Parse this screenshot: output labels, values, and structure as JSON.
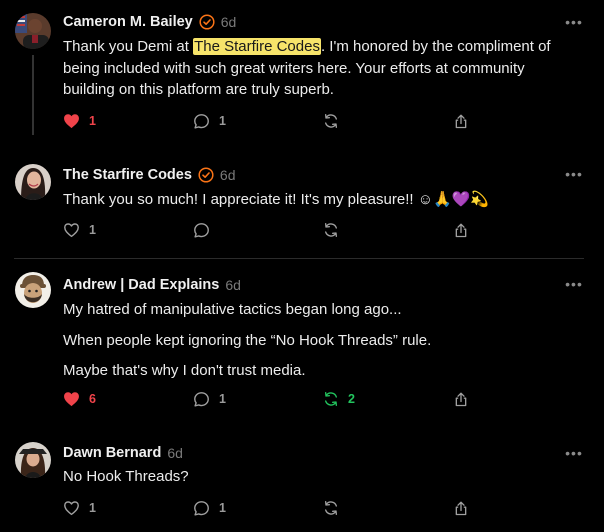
{
  "accent_color": "#f97316",
  "highlight_color": "#f7e46a",
  "like_active_color": "#f0434a",
  "repost_active_color": "#22c55e",
  "comments": [
    {
      "name": "Cameron M. Bailey",
      "verified": true,
      "time": "6d",
      "text_before": "Thank you Demi at ",
      "highlight": "The Starfire Codes",
      "text_after": ". I'm honored by the compliment of being included with such great writers here. Your efforts at community building on this platform are truly superb.",
      "likes": "1",
      "liked": true,
      "replies": "1",
      "reposts": "",
      "more_icon": "ellipsis-icon"
    },
    {
      "name": "The Starfire Codes",
      "verified": true,
      "time": "6d",
      "text": "Thank you so much! I appreciate it! It's my pleasure!! ☺🙏💜💫",
      "likes": "1",
      "liked": false,
      "replies": "",
      "reposts": ""
    },
    {
      "name": "Andrew | Dad Explains",
      "verified": false,
      "time": "6d",
      "paragraphs": [
        "My hatred of manipulative tactics began long ago...",
        "When people kept ignoring the “No Hook Threads” rule.",
        "Maybe that's why I don't trust media."
      ],
      "likes": "6",
      "liked": true,
      "replies": "1",
      "reposts": "2",
      "reposted": true
    },
    {
      "name": "Dawn Bernard",
      "verified": false,
      "time": "6d",
      "text": "No Hook Threads?",
      "likes": "1",
      "liked": false,
      "replies": "1",
      "reposts": ""
    }
  ]
}
